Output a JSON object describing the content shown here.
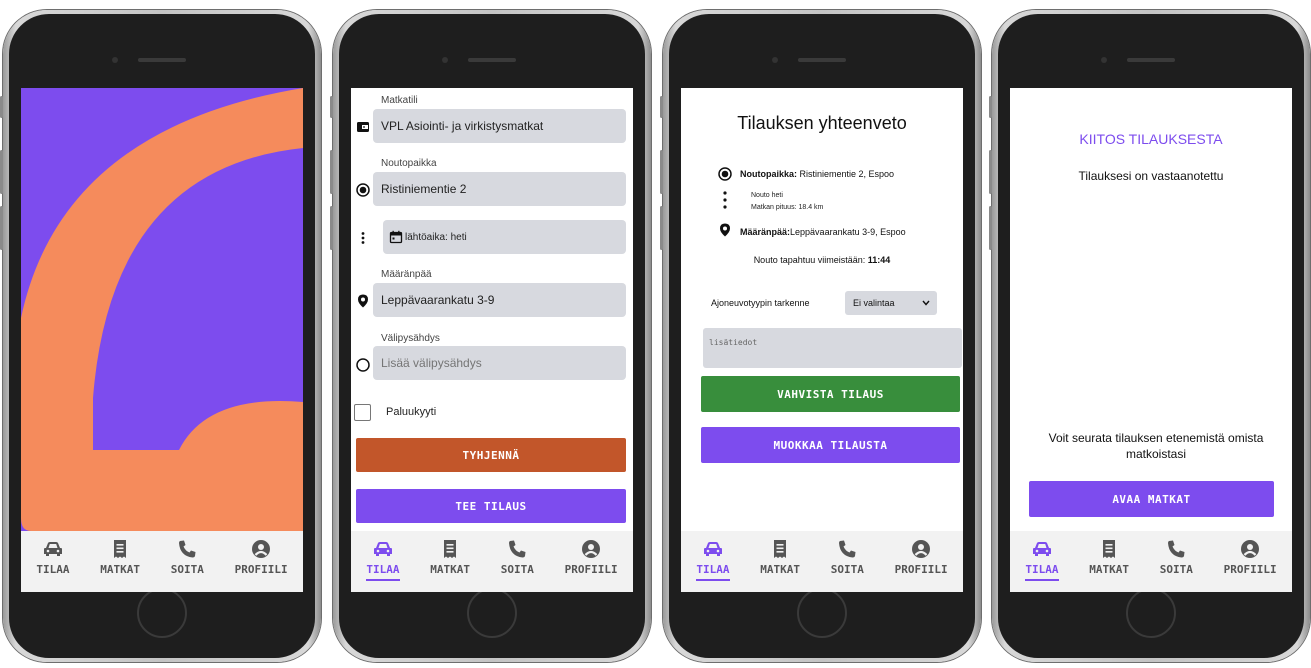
{
  "nav": {
    "items": [
      {
        "label": "TILAA",
        "icon": "car-icon"
      },
      {
        "label": "MATKAT",
        "icon": "receipt-icon"
      },
      {
        "label": "SOITA",
        "icon": "phone-icon"
      },
      {
        "label": "PROFIILI",
        "icon": "user-circle-icon"
      }
    ]
  },
  "colors": {
    "accent": "#7d4cee",
    "splash_orange": "#f58b5c",
    "clear_button": "#c2562a",
    "confirm_button": "#388e3c",
    "field_bg": "#d7d9df"
  },
  "order_form": {
    "account_label": "Matkatili",
    "account_value": "VPL Asiointi- ja virkistysmatkat",
    "pickup_label": "Noutopaikka",
    "pickup_value": "Ristiniementie 2",
    "departure_value": "lähtöaika: heti",
    "destination_label": "Määränpää",
    "destination_value": "Leppävaarankatu 3-9",
    "stopover_label": "Välipysähdys",
    "stopover_placeholder": "Lisää välipysähdys",
    "return_label": "Paluukyyti",
    "clear_button": "TYHJENNÄ",
    "submit_button": "TEE TILAUS"
  },
  "summary": {
    "title": "Tilauksen yhteenveto",
    "pickup_label": "Noutopaikka:",
    "pickup_value": " Ristiniementie 2, Espoo",
    "pickup_time": "Nouto heti",
    "distance": "Matkan pituus: 18.4 km",
    "destination_label": "Määränpää:",
    "destination_value": "Leppävaarankatu 3-9, Espoo",
    "eta_text": "Nouto tapahtuu viimeistään: ",
    "eta_time": "11:44",
    "vehicle_label": "Ajoneuvotyypin tarkenne",
    "vehicle_selected": "Ei valintaa",
    "notes_placeholder": "lisätiedot",
    "confirm_button": "VAHVISTA TILAUS",
    "edit_button": "MUOKKAA TILAUSTA"
  },
  "thanks": {
    "title": "KIITOS TILAUKSESTA",
    "received": "Tilauksesi on vastaanotettu",
    "follow": "Voit seurata tilauksen etenemistä omista matkoistasi",
    "open_button": "AVAA MATKAT"
  }
}
